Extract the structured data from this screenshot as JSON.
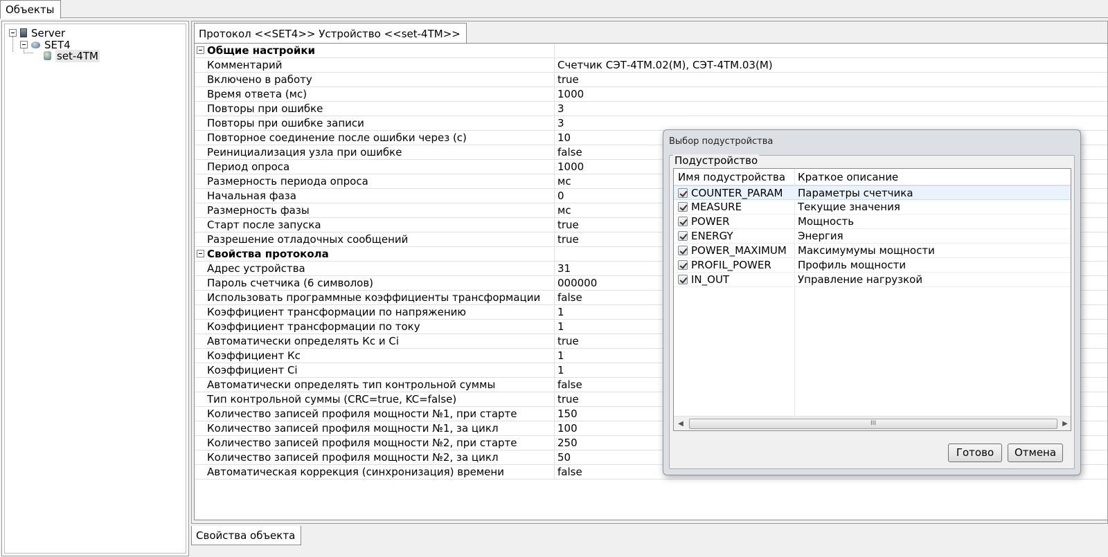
{
  "top_tab": {
    "label": "Объекты"
  },
  "tree": {
    "server": "Server",
    "protocol": "SET4",
    "device": "set-4TM"
  },
  "content_tab": {
    "label": "Протокол <<SET4>> Устройство <<set-4TM>>"
  },
  "bottom_tab": {
    "label": "Свойства объекта"
  },
  "properties": {
    "general": {
      "title": "Общие настройки",
      "rows": [
        {
          "name": "Комментарий",
          "value": "Счетчик СЭТ-4ТМ.02(М), СЭТ-4ТМ.03(М)"
        },
        {
          "name": "Включено в работу",
          "value": "true"
        },
        {
          "name": "Время ответа (мс)",
          "value": "1000"
        },
        {
          "name": "Повторы при ошибке",
          "value": "3"
        },
        {
          "name": "Повторы при ошибке записи",
          "value": "3"
        },
        {
          "name": "Повторное соединение после ошибки через (с)",
          "value": "10"
        },
        {
          "name": "Реинициализация узла при ошибке",
          "value": "false"
        },
        {
          "name": "Период опроса",
          "value": "1000"
        },
        {
          "name": "Размерность периода опроса",
          "value": "мс"
        },
        {
          "name": "Начальная фаза",
          "value": "0"
        },
        {
          "name": "Размерность фазы",
          "value": "мс"
        },
        {
          "name": "Старт после запуска",
          "value": "true"
        },
        {
          "name": "Разрешение отладочных сообщений",
          "value": "true"
        }
      ]
    },
    "protocol": {
      "title": "Свойства протокола",
      "rows": [
        {
          "name": "Адрес  устройства",
          "value": "31"
        },
        {
          "name": "Пароль счетчика (6 символов)",
          "value": "000000"
        },
        {
          "name": "Использовать программные коэффициенты трансформации",
          "value": "false"
        },
        {
          "name": "Коэффициент трансформации по напряжению",
          "value": "1"
        },
        {
          "name": "Коэффициент трансформации по току",
          "value": "1"
        },
        {
          "name": "Автоматически определять Кс и Ci",
          "value": "true"
        },
        {
          "name": "Коэффициент Кс",
          "value": "1"
        },
        {
          "name": "Коэффициент Ci",
          "value": "1"
        },
        {
          "name": "Автоматически определять тип контрольной суммы",
          "value": "false"
        },
        {
          "name": "Тип контрольной суммы (CRC=true, KC=false)",
          "value": "true"
        },
        {
          "name": "Количество записей профиля мощности №1, при старте",
          "value": "150"
        },
        {
          "name": "Количество записей профиля мощности №1, за цикл",
          "value": "100"
        },
        {
          "name": "Количество записей профиля мощности №2, при старте",
          "value": "250"
        },
        {
          "name": "Количество записей профиля мощности №2, за цикл",
          "value": "50"
        },
        {
          "name": "Автоматическая коррекция (синхронизация) времени",
          "value": "false"
        }
      ]
    }
  },
  "dialog": {
    "title": "Выбор подустройства",
    "group_label": "Подустройство",
    "columns": [
      "Имя подустройства",
      "Краткое описание"
    ],
    "rows": [
      {
        "name": "COUNTER_PARAM",
        "desc": "Параметры счетчика",
        "checked": true
      },
      {
        "name": "MEASURE",
        "desc": "Текущие значения",
        "checked": true
      },
      {
        "name": "POWER",
        "desc": "Мощность",
        "checked": true
      },
      {
        "name": "ENERGY",
        "desc": "Энергия",
        "checked": true
      },
      {
        "name": "POWER_MAXIMUM",
        "desc": "Максимумумы мощности",
        "checked": true
      },
      {
        "name": "PROFIL_POWER",
        "desc": "Профиль мощности",
        "checked": true
      },
      {
        "name": "IN_OUT",
        "desc": "Управление нагрузкой",
        "checked": true
      }
    ],
    "scroll_thumb": "III",
    "scroll_left": "◀",
    "scroll_right": "▶",
    "ok_label": "Готово",
    "cancel_label": "Отмена"
  }
}
